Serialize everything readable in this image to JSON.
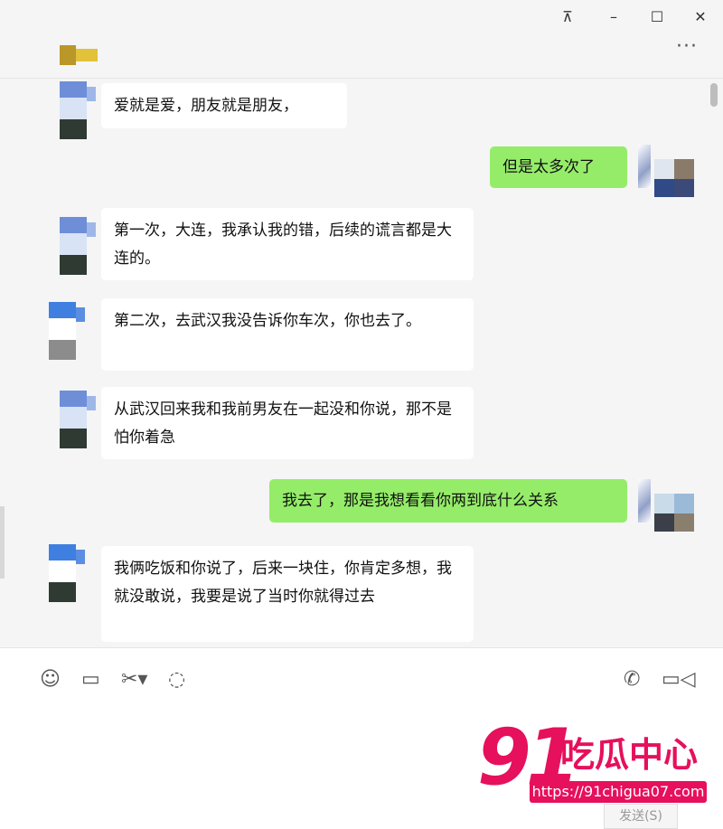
{
  "window": {
    "controls": {
      "pin": "⊼",
      "minimize": "–",
      "maximize": "☐",
      "close": "✕"
    },
    "more_label": "···"
  },
  "messages": [
    {
      "side": "left",
      "text": "爱就是爱，朋友就是朋友，"
    },
    {
      "side": "right",
      "text": "但是太多次了"
    },
    {
      "side": "left",
      "text": "第一次，大连，我承认我的错，后续的谎言都是大连的。"
    },
    {
      "side": "left",
      "text": "第二次，去武汉我没告诉你车次，你也去了。"
    },
    {
      "side": "left",
      "text": "从武汉回来我和我前男友在一起没和你说，那不是怕你着急"
    },
    {
      "side": "right",
      "text": "我去了，那是我想看看你两到底什么关系"
    },
    {
      "side": "left",
      "text": "我俩吃饭和你说了，后来一块住，你肯定多想，我就没敢说，我要是说了当时你就得过去"
    }
  ],
  "toolbar": {
    "emoji": "☺",
    "folder": "▭",
    "scissors": "✂▾",
    "chat_history": "◌",
    "voice_call": "✆",
    "video_call": "▭◁"
  },
  "send_button": "发送(S)",
  "watermark": {
    "logo": "91",
    "name": "吃瓜中心",
    "url": "https://91chigua07.com"
  },
  "colors": {
    "sent_bubble": "#95ec69",
    "received_bubble": "#ffffff",
    "watermark": "#e6105c"
  }
}
